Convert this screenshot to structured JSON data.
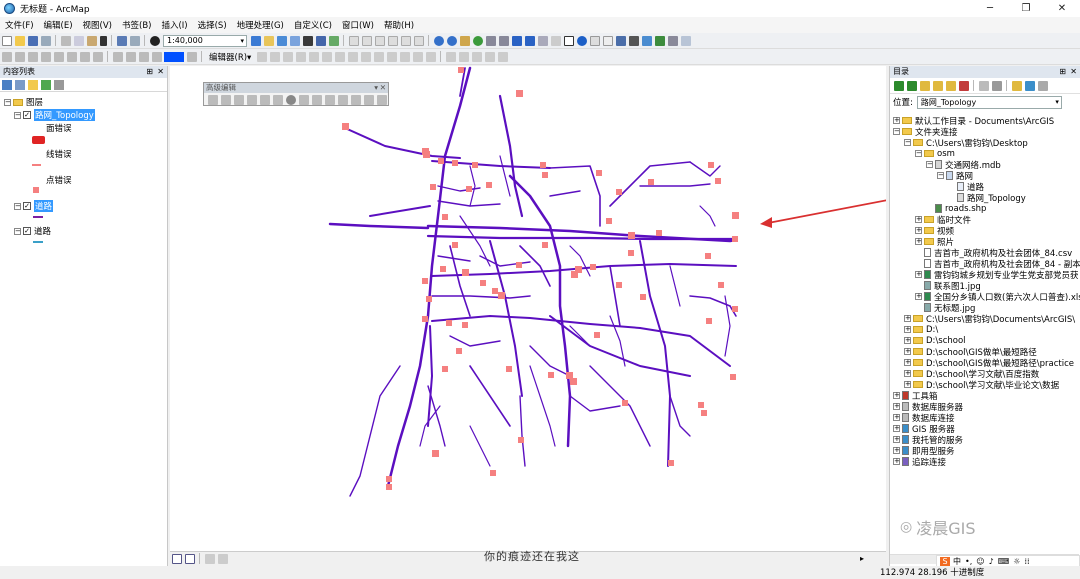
{
  "window": {
    "title": "无标题 - ArcMap"
  },
  "menu": [
    "文件(F)",
    "编辑(E)",
    "视图(V)",
    "书签(B)",
    "插入(I)",
    "选择(S)",
    "地理处理(G)",
    "自定义(C)",
    "窗口(W)",
    "帮助(H)"
  ],
  "toolbar": {
    "scale": "1:40,000",
    "editor": "编辑器(R)▾"
  },
  "toc": {
    "title": "内容列表",
    "root": "图层",
    "topology_layer": "路网_Topology",
    "legend": [
      "面错误",
      "线错误",
      "点错误"
    ],
    "layer2": "道路",
    "layer3": "道路"
  },
  "adv_edit": {
    "title": "高级编辑"
  },
  "catalog": {
    "title": "目录",
    "location_label": "位置:",
    "location_value": "路网_Topology",
    "tree": [
      "默认工作目录 - Documents\\ArcGIS",
      "文件夹连接",
      "C:\\Users\\雷钧钧\\Desktop",
      "osm",
      "交通网络.mdb",
      "路网",
      "道路",
      "路网_Topology",
      "roads.shp",
      "临时文件",
      "视频",
      "照片",
      "吉首市_政府机构及社会团体_84.csv",
      "吉首市_政府机构及社会团体_84 - 副本",
      "雷钧钧城乡规划专业学生党支部党员获",
      "联系图1.jpg",
      "全国分乡镇人口数(第六次人口普查).xls",
      "无标题.jpg",
      "C:\\Users\\雷钧钧\\Documents\\ArcGIS\\",
      "D:\\",
      "D:\\school",
      "D:\\school\\GIS做单\\最短路径",
      "D:\\school\\GIS做单\\最短路径\\practice",
      "D:\\school\\学习文献\\百度指数",
      "D:\\school\\学习文献\\毕业论文\\数据",
      "工具箱",
      "数据库服务器",
      "数据库连接",
      "GIS 服务器",
      "我托管的服务",
      "即用型服务",
      "追踪连接"
    ]
  },
  "status": {
    "coords": "112.974  28.196 十进制度"
  },
  "overlay": {
    "subtitle": "你的痕迹还在我这",
    "watermark": "凌晨GIS"
  },
  "colors": {
    "roads": "#5b0fc0",
    "error_points": "#f58080",
    "arrow": "#d93030",
    "highlight": "#3399ff"
  }
}
